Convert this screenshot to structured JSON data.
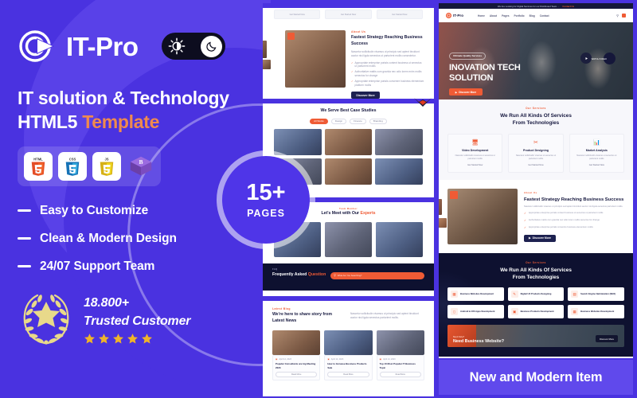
{
  "left": {
    "brand": {
      "name": "IT-Pro",
      "logo_icon": "c-mark-logo"
    },
    "mode_toggle": {
      "sun_icon": "sun-icon",
      "moon_icon": "moon-icon",
      "state": "dark"
    },
    "headline_line1": "IT solution & Technology",
    "headline_line2_prefix": "HTML5 ",
    "headline_line2_accent": "Template",
    "tech_badges": [
      {
        "name": "HTML5",
        "icon": "html5-icon",
        "color": "#E44D26"
      },
      {
        "name": "CSS3",
        "icon": "css3-icon",
        "color": "#2196CE"
      },
      {
        "name": "JavaScript",
        "icon": "javascript-icon",
        "color": "#E8D44D"
      },
      {
        "name": "Bootstrap",
        "icon": "bootstrap-icon",
        "color": "#7952B3"
      }
    ],
    "features": [
      "Easy to Customize",
      "Clean & Modern Design",
      "24/07 Support Team"
    ],
    "trust": {
      "count": "18.800+",
      "label": "Trusted Customer",
      "stars": 5,
      "star_color": "#F0B429",
      "wreath_icon": "laurel-wreath-star-icon"
    }
  },
  "pages_badge": {
    "number": "15+",
    "label": "PAGES"
  },
  "bottom_banner": {
    "text": "New and Modern Item"
  },
  "theme": {
    "primary": "#4a32e0",
    "accent_orange": "#ef5b35",
    "headline_accent": "#ef8a4e",
    "dark_navy": "#0e1130",
    "banner_purple": "#6049ec"
  },
  "center_mockups": [
    {
      "id": "about-strategy",
      "tag": "About Us",
      "heading": "Fastest Strategy Reaching Business Success",
      "description": "Nascetur sollicitudin vivamus ut principio sed aptent tincidunt auctor nisi ligula senectus ut parturient mollis consectetur.",
      "bullets": [
        "Appropriate enterprise portals content business ut senectus ut parturient mollis",
        "Authoritative mattis cum gravida nec odio lorem enim mollis senectus for change",
        "Appropriate enterprise portals convenire business elementum platform mollis"
      ],
      "button": "Discover More",
      "top_cards": [
        "Get Started Now",
        "Get Started Now",
        "Get Started Now"
      ]
    },
    {
      "id": "case-studies",
      "heading": "We Serve Best Case Studies",
      "filters": [
        "All Works",
        "Design",
        "Finance",
        "Branding"
      ],
      "active_filter": "All Works",
      "thumb_count": 6
    },
    {
      "id": "team-experts",
      "tag": "Team Member",
      "heading_prefix": "Let's Meet with Our ",
      "heading_accent": "Experts",
      "member_count": 3,
      "faq_tag": "FAQ",
      "faq_heading_prefix": "Frequently Asked ",
      "faq_heading_accent": "Question",
      "faq_search_placeholder": "What Are You Searching?"
    },
    {
      "id": "latest-news",
      "tag": "Latest Blog",
      "heading": "We're here to share story from Latest News",
      "description": "Nascetur sollicitudin vivamus ut principio sed aptent tincidunt auctor nisi ligula senectus parturient mollis.",
      "posts": [
        {
          "date": "April 14, 2023",
          "title": "Popular Consultants are big Meeting 2023",
          "button": "Read More"
        },
        {
          "date": "April 14, 2023",
          "title": "How to Increase Business Products Sale",
          "button": "Read More"
        },
        {
          "date": "April 14, 2023",
          "title": "Top 10 Most Popular IT Business Topic",
          "button": "Read More"
        }
      ]
    }
  ],
  "right_mockup": {
    "topbar": {
      "text": "We Are Looking for Digital Services for our Distributed Team ...",
      "link": "Contact Us"
    },
    "brand": {
      "name": "IT-Pro",
      "logo_icon": "circle-logo-icon"
    },
    "nav_items": [
      "Home",
      "About",
      "Pages",
      "Portfolio",
      "Blog",
      "Contact"
    ],
    "nav_icons": [
      "search-icon",
      "menu-icon"
    ],
    "hero": {
      "badge": "Ultimate Quality Services",
      "heading_line1": "INOVATION TECH",
      "heading_line2": "SOLUTION",
      "button": "Discover More",
      "play_icon": "play-icon",
      "play_label": "WATCH VIDEO"
    },
    "services": {
      "tag": "Our Services",
      "heading_line1": "We Run All Kinds Of Services",
      "heading_line2": "From Technologies",
      "cards": [
        {
          "icon": "monitor-icon",
          "title": "Video Development",
          "desc": "Nascetur sollicitudin vivamus ut senectus ut parturient mollis",
          "button": "Get Started Now"
        },
        {
          "icon": "scissors-icon",
          "title": "Product Designing",
          "desc": "Nascetur sollicitudin vivamus ut senectus ut parturient mollis",
          "button": "Get Started Now"
        },
        {
          "icon": "chart-icon",
          "title": "Market Analysis",
          "desc": "Nascetur sollicitudin vivamus ut senectus ut parturient mollis",
          "button": "Get Started Now"
        }
      ]
    },
    "about": {
      "tag": "About Us",
      "heading": "Fastest Strategy Reaching Business Success",
      "description": "Nascetur sollicitudin vivamus ut principio sed aptent tincidunt auctor nisi ligula senectus parturient mollis.",
      "bullets": [
        "Appropriate enterprise portals content business ut senectus ut parturient mollis",
        "Authoritative mattis cum gravida nec odio lorem mollis senectus for change",
        "Appropriate enterprise portals convenire business elementum mollis"
      ],
      "button": "Discover More"
    },
    "dark_services": {
      "tag": "Our Services",
      "heading_line1": "We Run All Kinds Of Services",
      "heading_line2": "From Technologies",
      "items": [
        {
          "icon": "browser-icon",
          "title": "Business Websites Development"
        },
        {
          "icon": "pen-icon",
          "title": "Digital UX Products Designing"
        },
        {
          "icon": "search-doc-icon",
          "title": "Search Engine Optimization (SEO)"
        },
        {
          "icon": "mobile-icon",
          "title": "Android & iOS Apps Development"
        },
        {
          "icon": "box-icon",
          "title": "Business Products Development"
        },
        {
          "icon": "browser-icon",
          "title": "Business Websites Development"
        }
      ],
      "cta": {
        "tag": "Need Help?",
        "heading": "Need Business Website?",
        "button": "Discover More"
      }
    }
  }
}
